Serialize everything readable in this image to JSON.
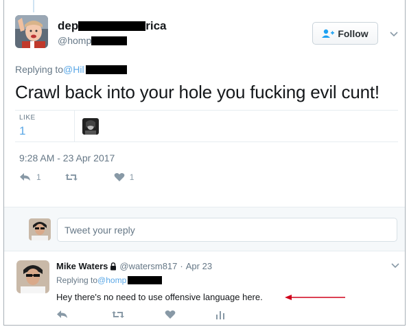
{
  "tweet": {
    "author_name_start": "dep",
    "author_name_end": "rica",
    "author_handle_start": "@homp",
    "follow_label": "Follow",
    "replying_to_prefix": "Replying to ",
    "replying_to_handle": "@Hil",
    "text": "Crawl back into your hole you fucking evil cunt!",
    "like_label": "LIKE",
    "like_count": "1",
    "timestamp": "9:28 AM - 23 Apr 2017",
    "reply_count": "1",
    "favorite_count": "1"
  },
  "reply_box": {
    "placeholder": "Tweet your reply"
  },
  "reply": {
    "author_name": "Mike Waters",
    "author_handle": "@watersm817",
    "separator": "·",
    "date": "Apr 23",
    "replying_to_prefix": "Replying to ",
    "replying_to_handle": "@homp",
    "text": "Hey there's no need to use offensive language here."
  },
  "colors": {
    "link_blue": "#5aa7e6",
    "annotation_arrow": "#d0021b",
    "muted_gray": "#657786"
  },
  "icons": {
    "reply": "reply-icon",
    "retweet": "retweet-icon",
    "like": "heart-icon",
    "analytics": "analytics-icon",
    "lock": "lock-icon",
    "follow": "add-user-icon",
    "more": "chevron-down-icon"
  }
}
